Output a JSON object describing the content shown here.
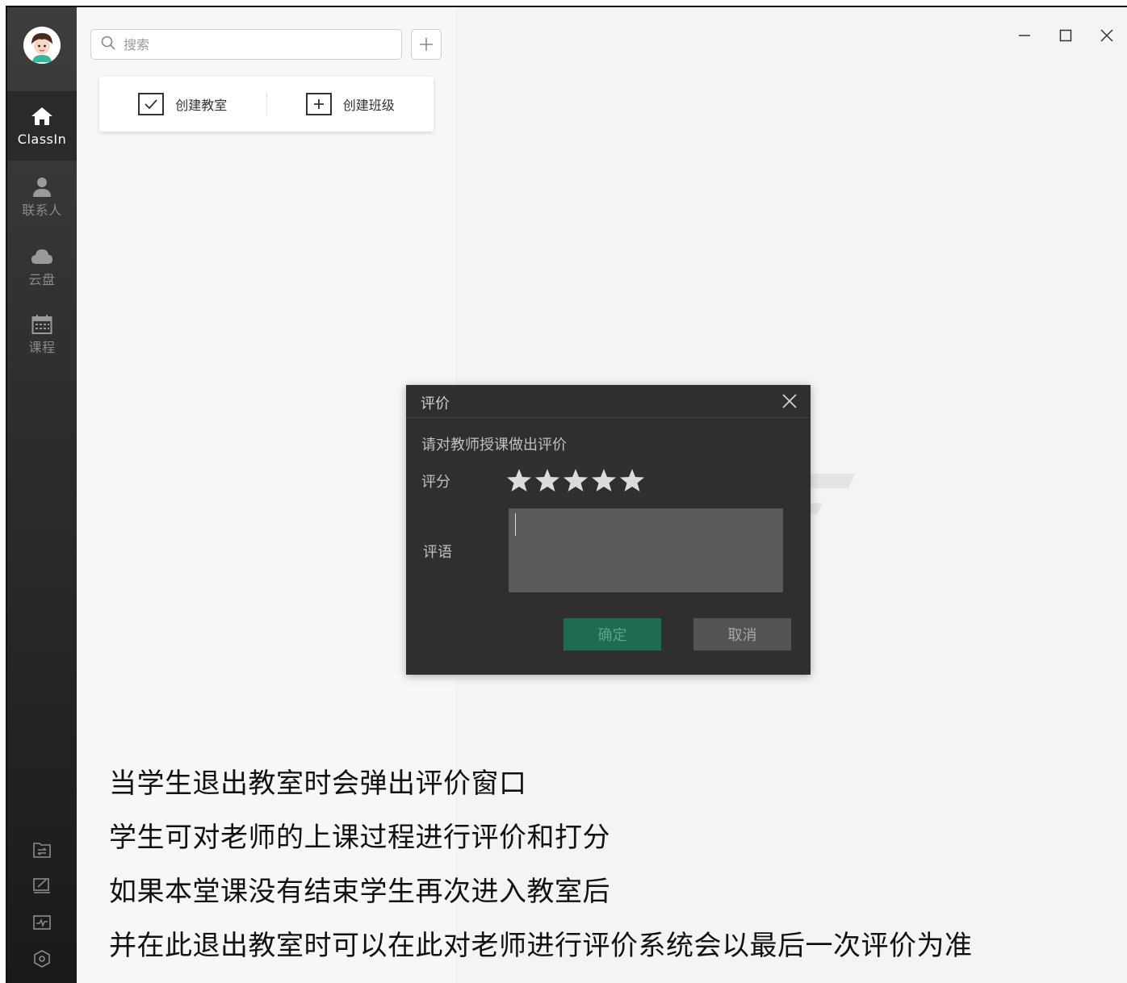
{
  "sidebar": {
    "items": [
      {
        "label": "ClassIn",
        "icon": "home-icon",
        "active": true
      },
      {
        "label": "联系人",
        "icon": "person-icon",
        "active": false
      },
      {
        "label": "云盘",
        "icon": "cloud-icon",
        "active": false
      },
      {
        "label": "课程",
        "icon": "calendar-icon",
        "active": false
      }
    ],
    "bottom_icons": [
      "folder-transfer-icon",
      "edit-note-icon",
      "activity-icon",
      "settings-hex-icon"
    ]
  },
  "search": {
    "placeholder": "搜索",
    "value": ""
  },
  "create_actions": {
    "create_classroom": "创建教室",
    "create_class": "创建班级"
  },
  "dialog": {
    "title": "评价",
    "prompt": "请对教师授课做出评价",
    "score_label": "评分",
    "rating": 5,
    "rating_max": 5,
    "comment_label": "评语",
    "comment_value": "",
    "confirm_label": "确定",
    "cancel_label": "取消"
  },
  "caption": {
    "lines": [
      "当学生退出教室时会弹出评价窗口",
      "学生可对老师的上课过程进行评价和打分",
      "如果本堂课没有结束学生再次进入教室后",
      "并在此退出教室时可以在此对老师进行评价系统会以最后一次评价为准"
    ]
  },
  "colors": {
    "confirm_button": "#1e6b51",
    "cancel_button": "#545454",
    "dialog_bg": "#2f2f2f",
    "sidebar_bg": "#2e2e2e"
  }
}
